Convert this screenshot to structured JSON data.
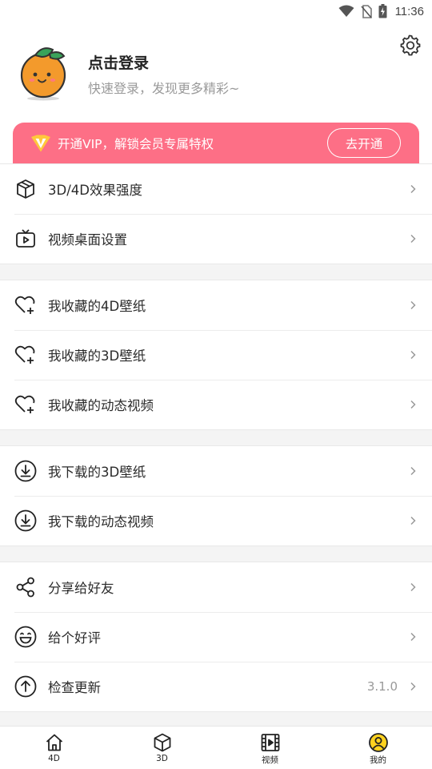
{
  "status_bar": {
    "time": "11:36"
  },
  "profile": {
    "name": "点击登录",
    "subtitle": "快速登录，发现更多精彩~"
  },
  "vip": {
    "text": "开通VIP，解锁会员专属特权",
    "button": "去开通"
  },
  "menu": {
    "group1": [
      {
        "label": "3D/4D效果强度",
        "icon": "cube-icon"
      },
      {
        "label": "视频桌面设置",
        "icon": "tv-play-icon"
      }
    ],
    "group2": [
      {
        "label": "我收藏的4D壁纸",
        "icon": "heart-plus-icon"
      },
      {
        "label": "我收藏的3D壁纸",
        "icon": "heart-plus-icon"
      },
      {
        "label": "我收藏的动态视频",
        "icon": "heart-plus-icon"
      }
    ],
    "group3": [
      {
        "label": "我下载的3D壁纸",
        "icon": "download-circle-icon"
      },
      {
        "label": "我下载的动态视频",
        "icon": "download-circle-icon"
      }
    ],
    "group4": [
      {
        "label": "分享给好友",
        "icon": "share-icon"
      },
      {
        "label": "给个好评",
        "icon": "smile-icon"
      },
      {
        "label": "检查更新",
        "icon": "upload-circle-icon",
        "value": "3.1.0"
      }
    ]
  },
  "tabs": [
    {
      "label": "4D",
      "icon": "home-icon"
    },
    {
      "label": "3D",
      "icon": "cube-icon"
    },
    {
      "label": "视频",
      "icon": "film-icon"
    },
    {
      "label": "我的",
      "icon": "user-circle-icon",
      "active": true
    }
  ],
  "colors": {
    "vip_banner": "#fd6f86",
    "active_tab": "#ffd21f"
  }
}
